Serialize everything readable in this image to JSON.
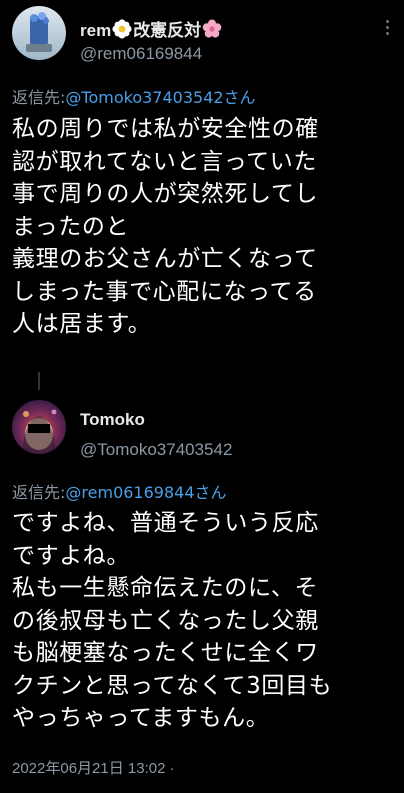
{
  "tweets": [
    {
      "display_name": "rem",
      "name_suffix": "改憲反対",
      "handle": "@rem06169844",
      "replying_prefix": "返信先:",
      "replying_to": "@Tomoko37403542さん",
      "text": "私の周りでは私が安全性の確\n認が取れてないと言っていた\n事で周りの人が突然死してし\nまったのと\n義理のお父さんが亡くなって\nしまった事で心配になってる\n人は居ます。"
    },
    {
      "display_name": "Tomoko",
      "handle": "@Tomoko37403542",
      "replying_prefix": "返信先:",
      "replying_to": "@rem06169844さん",
      "text": "ですよね、普通そういう反応\nですよね。\n私も一生懸命伝えたのに、そ\nの後叔母も亡くなったし父親\nも脳梗塞なったくせに全くワ\nクチンと思ってなくて3回目も\nやっちゃってますもん。",
      "timestamp": "2022年06月21日 13:02 ·"
    }
  ],
  "icons": {
    "flower": "white-flower-icon",
    "blossom": "pink-blossom-icon",
    "more": "more-options-icon"
  },
  "colors": {
    "background": "#000000",
    "text": "#ffffff",
    "secondary": "#8b98a5",
    "link": "#4a9fe8"
  }
}
